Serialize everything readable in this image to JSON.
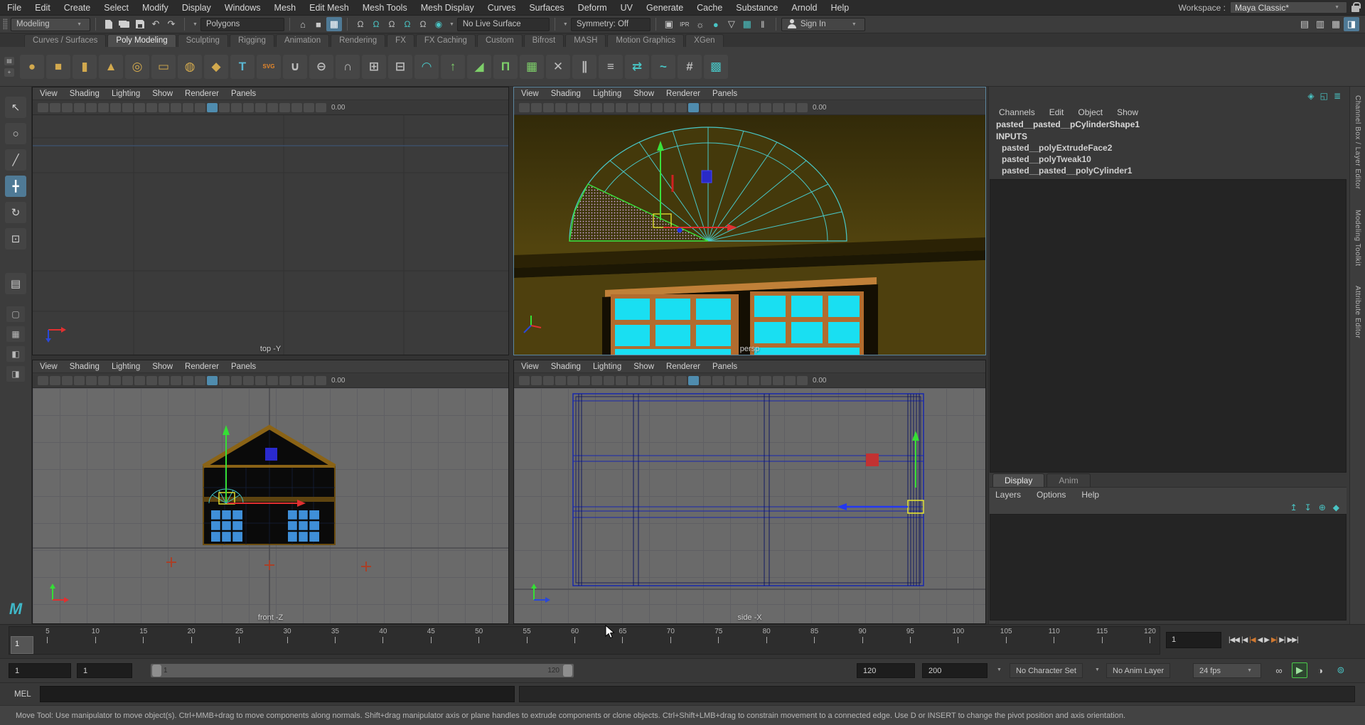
{
  "window": {
    "workspace_label": "Workspace :",
    "workspace_value": "Maya Classic*"
  },
  "menu_bar": {
    "items": [
      "File",
      "Edit",
      "Create",
      "Select",
      "Modify",
      "Display",
      "Windows",
      "Mesh",
      "Edit Mesh",
      "Mesh Tools",
      "Mesh Display",
      "Curves",
      "Surfaces",
      "Deform",
      "UV",
      "Generate",
      "Cache",
      "Substance",
      "Arnold",
      "Help"
    ]
  },
  "status_line": {
    "mode_dropdown": "Modeling",
    "file_icons": [
      {
        "name": "new-scene-icon",
        "cls": "i-doc"
      },
      {
        "name": "open-scene-icon",
        "cls": "i-folder"
      },
      {
        "name": "save-scene-icon",
        "cls": "i-save"
      },
      {
        "name": "undo-icon",
        "glyph": "↶"
      },
      {
        "name": "redo-icon",
        "glyph": "↷"
      }
    ],
    "selection_dropdown": "Polygons",
    "mask_icons": [
      {
        "name": "select-hierarchy-icon",
        "glyph": "⌂"
      },
      {
        "name": "select-object-icon",
        "glyph": "■"
      },
      {
        "name": "select-component-icon",
        "glyph": "▦",
        "active": true
      }
    ],
    "snap_icons": [
      {
        "name": "snap-to-grid-icon",
        "glyph": "Ω"
      },
      {
        "name": "snap-to-curves-icon",
        "glyph": "Ω",
        "color": "#49c4c4"
      },
      {
        "name": "snap-to-points-icon",
        "glyph": "Ω"
      },
      {
        "name": "snap-to-projected-center-icon",
        "glyph": "Ω",
        "color": "#49c4c4"
      },
      {
        "name": "snap-to-view-plane-icon",
        "glyph": "Ω"
      },
      {
        "name": "make-live-icon",
        "glyph": "◉",
        "color": "#49c4c4"
      }
    ],
    "live_surface": "No Live Surface",
    "symmetry": "Symmetry: Off",
    "render_icons": [
      {
        "name": "render-view-icon",
        "glyph": "▣"
      },
      {
        "name": "ipr-render-icon",
        "glyph": "IPR",
        "small": true
      },
      {
        "name": "render-settings-icon",
        "glyph": "☼"
      },
      {
        "name": "hypershade-icon",
        "glyph": "●",
        "color": "#49c4c4"
      },
      {
        "name": "light-editor-icon",
        "glyph": "▽"
      },
      {
        "name": "render-setup-icon",
        "glyph": "▦",
        "color": "#49c4c4"
      },
      {
        "name": "pause-viewport-icon",
        "glyph": "‖"
      }
    ],
    "sign_in": "Sign In",
    "panel_toggle_icons": [
      {
        "name": "toggle-modeling-toolkit-icon",
        "glyph": "▤"
      },
      {
        "name": "toggle-attribute-editor-icon",
        "glyph": "▥"
      },
      {
        "name": "toggle-tool-settings-icon",
        "glyph": "▦"
      },
      {
        "name": "toggle-channel-box-icon",
        "glyph": "◨",
        "active": true
      }
    ]
  },
  "shelf": {
    "mini_icons": [
      {
        "name": "shelf-tab-list-icon",
        "glyph": "▤"
      },
      {
        "name": "shelf-menu-icon",
        "glyph": "+"
      }
    ],
    "tabs": [
      {
        "label": "Curves / Surfaces"
      },
      {
        "label": "Poly Modeling",
        "active": true
      },
      {
        "label": "Sculpting"
      },
      {
        "label": "Rigging"
      },
      {
        "label": "Animation"
      },
      {
        "label": "Rendering"
      },
      {
        "label": "FX"
      },
      {
        "label": "FX Caching"
      },
      {
        "label": "Custom"
      },
      {
        "label": "Bifrost"
      },
      {
        "label": "MASH"
      },
      {
        "label": "Motion Graphics"
      },
      {
        "label": "XGen"
      }
    ],
    "icons": [
      {
        "name": "poly-sphere-icon",
        "glyph": "●",
        "color": "#d2a94e"
      },
      {
        "name": "poly-cube-icon",
        "glyph": "■",
        "color": "#d2a94e"
      },
      {
        "name": "poly-cylinder-icon",
        "glyph": "▮",
        "color": "#d2a94e"
      },
      {
        "name": "poly-cone-icon",
        "glyph": "▲",
        "color": "#d2a94e"
      },
      {
        "name": "poly-torus-icon",
        "glyph": "◎",
        "color": "#d2a94e"
      },
      {
        "name": "poly-plane-icon",
        "glyph": "▭",
        "color": "#d2a94e"
      },
      {
        "name": "poly-disc-icon",
        "glyph": "◍",
        "color": "#d2a94e"
      },
      {
        "name": "platonic-solid-icon",
        "glyph": "◆",
        "color": "#d2a94e"
      },
      {
        "name": "type-tool-icon",
        "glyph": "T",
        "color": "#5ab8d4"
      },
      {
        "name": "svg-tool-icon",
        "glyph": "SVG",
        "color": "#e8882a",
        "small": true
      },
      {
        "name": "boolean-union-icon",
        "glyph": "∪",
        "color": "#bcbcbc"
      },
      {
        "name": "boolean-difference-icon",
        "glyph": "⊖",
        "color": "#bcbcbc"
      },
      {
        "name": "boolean-intersection-icon",
        "glyph": "∩",
        "color": "#bcbcbc"
      },
      {
        "name": "combine-icon",
        "glyph": "⊞",
        "color": "#bcbcbc"
      },
      {
        "name": "separate-icon",
        "glyph": "⊟",
        "color": "#bcbcbc"
      },
      {
        "name": "smooth-icon",
        "glyph": "◠",
        "color": "#49c4c4"
      },
      {
        "name": "extrude-icon",
        "glyph": "↑",
        "color": "#7ed06a"
      },
      {
        "name": "bevel-icon",
        "glyph": "◢",
        "color": "#7ed06a"
      },
      {
        "name": "bridge-icon",
        "glyph": "Π",
        "color": "#7ed06a"
      },
      {
        "name": "quad-draw-icon",
        "glyph": "▦",
        "color": "#7ed06a"
      },
      {
        "name": "multi-cut-icon",
        "glyph": "✕",
        "color": "#bcbcbc"
      },
      {
        "name": "insert-edge-loop-icon",
        "glyph": "∥",
        "color": "#bcbcbc"
      },
      {
        "name": "offset-edge-loop-icon",
        "glyph": "≡",
        "color": "#bcbcbc"
      },
      {
        "name": "mirror-icon",
        "glyph": "⇄",
        "color": "#49c4c4"
      },
      {
        "name": "sculpt-tool-icon",
        "glyph": "~",
        "color": "#49c4c4"
      },
      {
        "name": "remesh-icon",
        "glyph": "#",
        "color": "#bcbcbc"
      },
      {
        "name": "retopologize-icon",
        "glyph": "▩",
        "color": "#49c4c4"
      }
    ]
  },
  "toolbox": {
    "tools": [
      {
        "name": "select-tool-icon",
        "glyph": "↖"
      },
      {
        "name": "lasso-tool-icon",
        "glyph": "○"
      },
      {
        "name": "paint-select-tool-icon",
        "glyph": "╱"
      },
      {
        "name": "move-tool-icon",
        "glyph": "╋",
        "active": true
      },
      {
        "name": "rotate-tool-icon",
        "glyph": "↻"
      },
      {
        "name": "scale-tool-icon",
        "glyph": "⊡"
      }
    ],
    "last_tool": [
      {
        "name": "last-tool-icon",
        "glyph": "▤"
      }
    ],
    "layouts": [
      {
        "name": "layout-single-pane-icon",
        "glyph": "▢"
      },
      {
        "name": "layout-four-pane-icon",
        "glyph": "▦"
      },
      {
        "name": "layout-persp-outliner-icon",
        "glyph": "◧"
      },
      {
        "name": "layout-hypershade-persp-icon",
        "glyph": "◨"
      }
    ],
    "logo": "M"
  },
  "viewport_menu": [
    "View",
    "Shading",
    "Lighting",
    "Show",
    "Renderer",
    "Panels"
  ],
  "vp_toolbar": [
    {
      "name": "camera-select-icon"
    },
    {
      "name": "camera-attributes-icon"
    },
    {
      "name": "camera-bookmark-icon"
    },
    {
      "name": "image-plane-icon"
    },
    {
      "name": "two-d-pan-zoom-icon"
    },
    {
      "name": "grease-pencil-icon"
    },
    {
      "name": "grid-toggle-icon"
    },
    {
      "name": "film-gate-icon"
    },
    {
      "name": "resolution-gate-icon"
    },
    {
      "name": "gate-mask-icon"
    },
    {
      "name": "field-chart-icon"
    },
    {
      "name": "safe-action-icon"
    },
    {
      "name": "safe-title-icon"
    },
    {
      "name": "wireframe-display-icon"
    },
    {
      "name": "shaded-display-icon",
      "active": true
    },
    {
      "name": "textured-display-icon"
    },
    {
      "name": "use-all-lights-icon"
    },
    {
      "name": "shadows-toggle-icon"
    },
    {
      "name": "screen-space-ao-icon"
    },
    {
      "name": "motion-blur-toggle-icon"
    },
    {
      "name": "multisample-aa-icon"
    },
    {
      "name": "xray-display-icon"
    },
    {
      "name": "isolate-select-icon"
    },
    {
      "name": "exposure-toggle-icon"
    }
  ],
  "vp_exposure": "0.00",
  "viewports": {
    "top": {
      "label": "top -Y"
    },
    "persp": {
      "label": "persp"
    },
    "front": {
      "label": "front -Z"
    },
    "side": {
      "label": "side -X"
    }
  },
  "channel_box": {
    "header_icons": [
      {
        "name": "cb-pin-panel-icon",
        "glyph": "◈"
      },
      {
        "name": "cb-pop-out-icon",
        "glyph": "◱"
      },
      {
        "name": "cb-panel-menu-icon",
        "glyph": "≣"
      }
    ],
    "menu": [
      "Channels",
      "Edit",
      "Object",
      "Show"
    ],
    "node_name": "pasted__pasted__pCylinderShape1",
    "section_label": "INPUTS",
    "inputs": [
      "pasted__polyExtrudeFace2",
      "pasted__polyTweak10",
      "pasted__pasted__polyCylinder1"
    ]
  },
  "layer_editor": {
    "tabs": [
      {
        "label": "Display",
        "active": true
      },
      {
        "label": "Anim"
      }
    ],
    "menu": [
      "Layers",
      "Options",
      "Help"
    ],
    "icons": [
      {
        "name": "layer-move-up-icon",
        "glyph": "↥"
      },
      {
        "name": "layer-move-down-icon",
        "glyph": "↧"
      },
      {
        "name": "new-layer-from-selected-icon",
        "glyph": "⊕"
      },
      {
        "name": "new-empty-layer-icon",
        "glyph": "◆"
      }
    ]
  },
  "side_strip": {
    "labels": [
      "Channel Box / Layer Editor",
      "Modeling Toolkit",
      "Attribute Editor"
    ]
  },
  "timeline": {
    "min": 1,
    "max": 121,
    "ticks": [
      5,
      10,
      15,
      20,
      25,
      30,
      35,
      40,
      45,
      50,
      55,
      60,
      65,
      70,
      75,
      80,
      85,
      90,
      95,
      100,
      105,
      110,
      115,
      120
    ],
    "current_frame": "1",
    "frame_field": "1",
    "playback": [
      {
        "name": "go-to-start-button",
        "glyph": "|◀◀"
      },
      {
        "name": "step-back-frame-button",
        "glyph": "|◀"
      },
      {
        "name": "step-back-key-button",
        "glyph": "|◀",
        "cls": "key"
      },
      {
        "name": "play-backwards-button",
        "glyph": "◀"
      },
      {
        "name": "play-forwards-button",
        "glyph": "▶"
      },
      {
        "name": "step-forward-key-button",
        "glyph": "▶|",
        "cls": "key"
      },
      {
        "name": "step-forward-frame-button",
        "glyph": "▶|"
      },
      {
        "name": "go-to-end-button",
        "glyph": "▶▶|"
      }
    ]
  },
  "range_slider": {
    "playback_start": "1",
    "anim_start": "1",
    "handle_start": "1",
    "handle_end": "120",
    "playback_end": "120",
    "anim_end": "200",
    "character_set": "No Character Set",
    "anim_layer": "No Anim Layer",
    "fps": "24 fps",
    "icons": [
      {
        "name": "playback-loop-icon",
        "glyph": "∞"
      },
      {
        "name": "playblast-icon",
        "glyph": "▶",
        "active": true
      },
      {
        "name": "time-marker-icon",
        "glyph": "◑"
      },
      {
        "name": "auto-keyframe-icon",
        "glyph": "⊚",
        "color": "#49c4c4"
      }
    ]
  },
  "command_line": {
    "label": "MEL"
  },
  "help_line": {
    "text": "Move Tool: Use manipulator to move object(s). Ctrl+MMB+drag to move components along normals. Shift+drag manipulator axis or plane handles to extrude components or clone objects. Ctrl+Shift+LMB+drag to constrain movement to a connected edge. Use D or INSERT to change the pivot position and axis orientation."
  },
  "colors": {
    "accent_blue": "#4f7a96",
    "teal": "#49c4c4",
    "gold": "#d2a94e",
    "axis_red": "#e03030",
    "axis_green": "#35df35",
    "axis_blue": "#2a48d8",
    "window_cyan": "#19dff2",
    "frame_orange": "#b06a2e",
    "wire_teal": "#49c8c8",
    "wire_blue": "#1827ad",
    "selection_yellow": "#e8e830"
  }
}
